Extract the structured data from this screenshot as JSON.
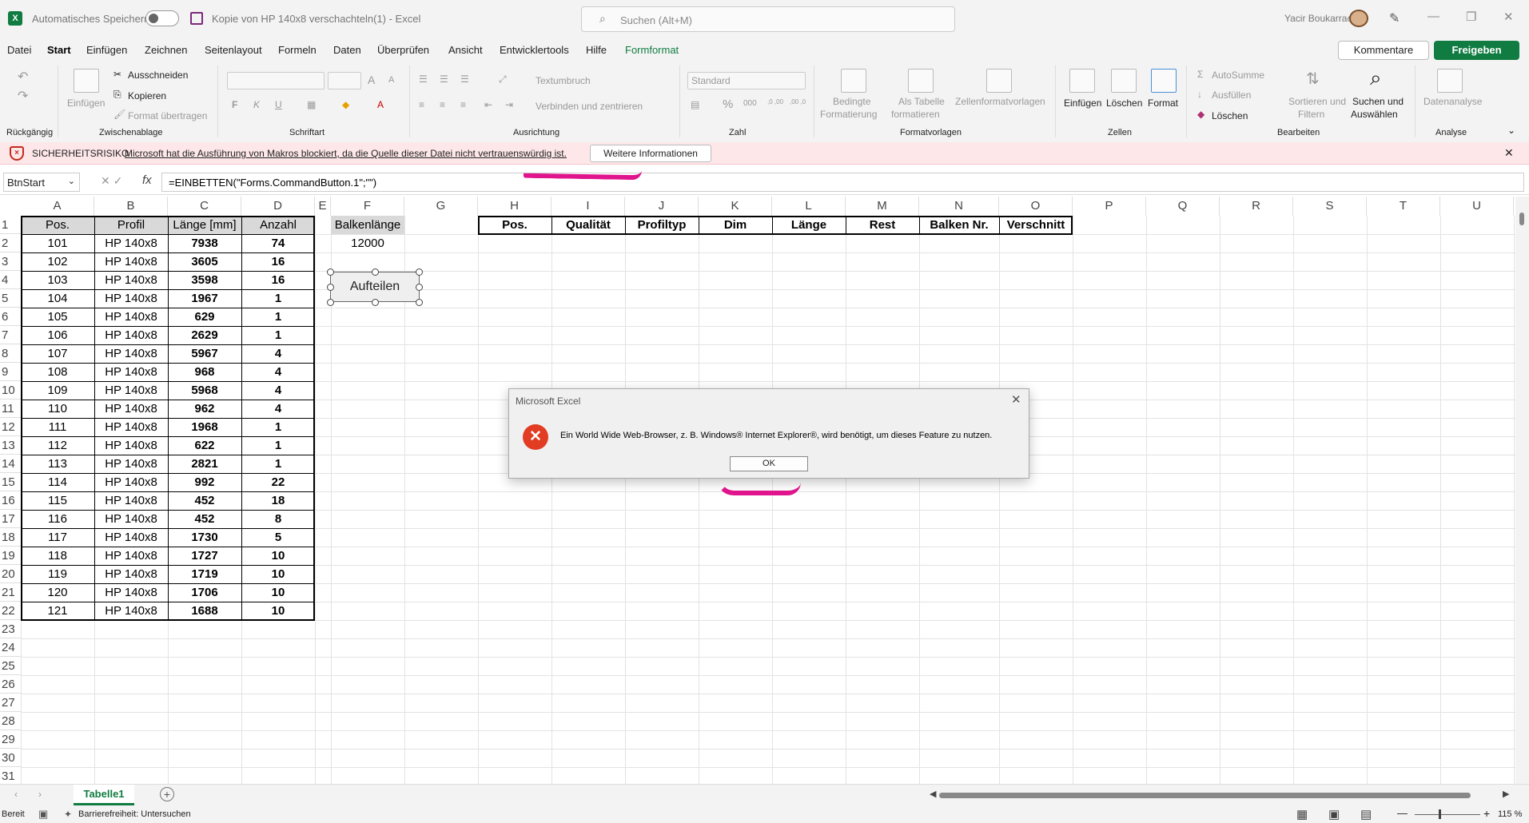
{
  "titlebar": {
    "autosave_label": "Automatisches Speichern",
    "document_title": "Kopie von HP 140x8 verschachteln(1)  -  Excel",
    "search_placeholder": "Suchen (Alt+M)",
    "user_name": "Yacir Boukarracha"
  },
  "menu": {
    "tabs": [
      "Datei",
      "Start",
      "Einfügen",
      "Zeichnen",
      "Seitenlayout",
      "Formeln",
      "Daten",
      "Überprüfen",
      "Ansicht",
      "Entwicklertools",
      "Hilfe",
      "Formformat"
    ],
    "active": "Start",
    "comments_label": "Kommentare",
    "share_label": "Freigeben"
  },
  "ribbon": {
    "undo_group": "Rückgängig",
    "clipboard": {
      "paste": "Einfügen",
      "cut": "Ausschneiden",
      "copy": "Kopieren",
      "format_painter": "Format übertragen",
      "group": "Zwischenablage"
    },
    "font": {
      "bold": "F",
      "italic": "K",
      "underline": "U",
      "grow": "A",
      "shrink": "A",
      "group": "Schriftart"
    },
    "alignment": {
      "wrap": "Textumbruch",
      "merge": "Verbinden und zentrieren",
      "group": "Ausrichtung"
    },
    "number": {
      "format": "Standard",
      "percent": "%",
      "thousands": "000",
      "inc_decimal": ",0 ,00",
      "dec_decimal": ",00 ,0",
      "group": "Zahl"
    },
    "styles": {
      "conditional_l1": "Bedingte",
      "conditional_l2": "Formatierung",
      "as_table_l1": "Als Tabelle",
      "as_table_l2": "formatieren",
      "cell_styles": "Zellenformatvorlagen",
      "group": "Formatvorlagen"
    },
    "cells": {
      "insert": "Einfügen",
      "delete": "Löschen",
      "format": "Format",
      "group": "Zellen"
    },
    "editing": {
      "autosum": "AutoSumme",
      "fill": "Ausfüllen",
      "clear": "Löschen",
      "sort_l1": "Sortieren und",
      "sort_l2": "Filtern",
      "find_l1": "Suchen und",
      "find_l2": "Auswählen",
      "group": "Bearbeiten"
    },
    "analysis": {
      "data_analysis": "Datenanalyse",
      "group": "Analyse"
    }
  },
  "security_bar": {
    "title": "SICHERHEITSRISIKO",
    "message": "Microsoft hat die Ausführung von Makros blockiert, da die Quelle dieser Datei nicht vertrauenswürdig ist.",
    "more_info": "Weitere Informationen"
  },
  "formula_bar": {
    "name_box": "BtnStart",
    "fx": "fx",
    "formula": "=EINBETTEN(\"Forms.CommandButton.1\";\"\")"
  },
  "sheet": {
    "columns": [
      "A",
      "B",
      "C",
      "D",
      "E",
      "F",
      "G",
      "H",
      "I",
      "J",
      "K",
      "L",
      "M",
      "N",
      "O",
      "P",
      "Q",
      "R",
      "S",
      "T",
      "U"
    ],
    "row_numbers": [
      "1",
      "2",
      "3",
      "4",
      "5",
      "6",
      "7",
      "8",
      "9",
      "10",
      "11",
      "12",
      "13",
      "14",
      "15",
      "16",
      "17",
      "18",
      "19",
      "20",
      "21",
      "22",
      "23",
      "24",
      "25",
      "26",
      "27",
      "28",
      "29",
      "30",
      "31"
    ],
    "table_headers": [
      "Pos.",
      "Profil",
      "Länge [mm]",
      "Anzahl"
    ],
    "table_rows": [
      [
        "101",
        "HP 140x8",
        "7938",
        "74"
      ],
      [
        "102",
        "HP 140x8",
        "3605",
        "16"
      ],
      [
        "103",
        "HP 140x8",
        "3598",
        "16"
      ],
      [
        "104",
        "HP 140x8",
        "1967",
        "1"
      ],
      [
        "105",
        "HP 140x8",
        "629",
        "1"
      ],
      [
        "106",
        "HP 140x8",
        "2629",
        "1"
      ],
      [
        "107",
        "HP 140x8",
        "5967",
        "4"
      ],
      [
        "108",
        "HP 140x8",
        "968",
        "4"
      ],
      [
        "109",
        "HP 140x8",
        "5968",
        "4"
      ],
      [
        "110",
        "HP 140x8",
        "962",
        "4"
      ],
      [
        "111",
        "HP 140x8",
        "1968",
        "1"
      ],
      [
        "112",
        "HP 140x8",
        "622",
        "1"
      ],
      [
        "113",
        "HP 140x8",
        "2821",
        "1"
      ],
      [
        "114",
        "HP 140x8",
        "992",
        "22"
      ],
      [
        "115",
        "HP 140x8",
        "452",
        "18"
      ],
      [
        "116",
        "HP 140x8",
        "452",
        "8"
      ],
      [
        "117",
        "HP 140x8",
        "1730",
        "5"
      ],
      [
        "118",
        "HP 140x8",
        "1727",
        "10"
      ],
      [
        "119",
        "HP 140x8",
        "1719",
        "10"
      ],
      [
        "120",
        "HP 140x8",
        "1706",
        "10"
      ],
      [
        "121",
        "HP 140x8",
        "1688",
        "10"
      ]
    ],
    "balken_header": "Balkenlänge",
    "balken_value": "12000",
    "button_label": "Aufteilen",
    "result_headers": [
      "Pos.",
      "Qualität",
      "Profiltyp",
      "Dim",
      "Länge",
      "Rest",
      "Balken Nr.",
      "Verschnitt"
    ]
  },
  "dialog": {
    "title": "Microsoft Excel",
    "message": "Ein World Wide Web-Browser, z. B. Windows® Internet Explorer®, wird benötigt, um dieses Feature zu nutzen.",
    "ok": "OK"
  },
  "sheet_tabs": {
    "active": "Tabelle1",
    "add": "+"
  },
  "status_bar": {
    "ready": "Bereit",
    "accessibility": "Barrierefreiheit: Untersuchen",
    "zoom": "115 %"
  },
  "colors": {
    "accent": "#107c41",
    "security_bg": "#fde7e9",
    "error": "#e23c23",
    "annotation": "#e0148c"
  }
}
